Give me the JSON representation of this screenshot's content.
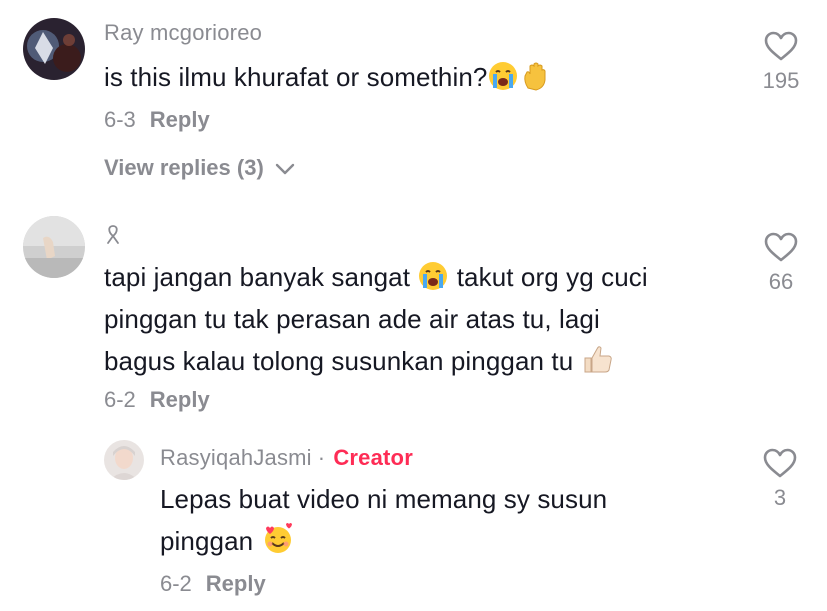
{
  "comments": [
    {
      "username": "Ray mcgorioreo",
      "text": "is this ilmu khurafat or somethin?",
      "date": "6-3",
      "reply_label": "Reply",
      "likes": "195",
      "view_replies": "View replies (3)",
      "emojis": [
        "loudly-crying-face-emoji",
        "raised-hand-emoji"
      ]
    },
    {
      "username": "",
      "text_line1": "tapi jangan banyak sangat",
      "text_line1b": "takut org yg cuci",
      "text_line2": "pinggan tu tak perasan ade air atas tu, lagi",
      "text_line3": "bagus kalau tolong susunkan pinggan tu",
      "date": "6-2",
      "reply_label": "Reply",
      "likes": "66",
      "emojis": [
        "loudly-crying-face-emoji",
        "thumbs-up-emoji"
      ]
    }
  ],
  "reply": {
    "username": "RasyiqahJasmi",
    "separator": "·",
    "badge": "Creator",
    "text_line1": "Lepas buat video ni memang sy susun",
    "text_line2": "pinggan",
    "date": "6-2",
    "reply_label": "Reply",
    "likes": "3",
    "emojis": [
      "smiling-face-with-hearts-emoji"
    ]
  },
  "colors": {
    "text": "#161823",
    "muted": "#8a8b91",
    "creator": "#fe2c55"
  }
}
